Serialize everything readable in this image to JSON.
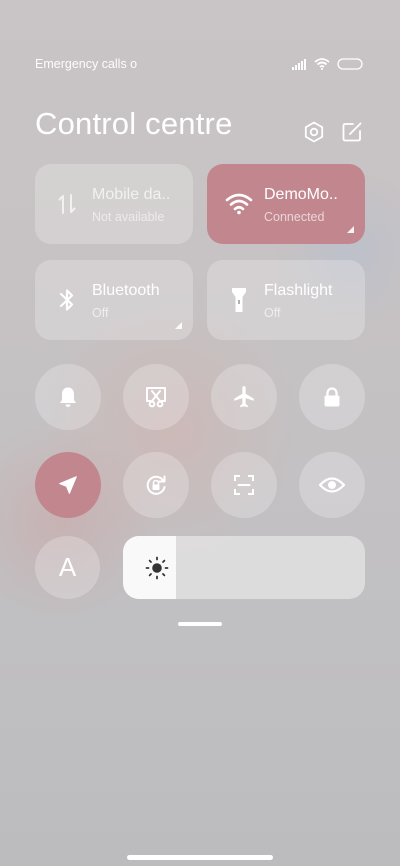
{
  "status_bar": {
    "carrier_text": "Emergency calls o"
  },
  "header": {
    "title": "Control centre"
  },
  "tiles": [
    {
      "label": "Mobile da..",
      "sub": "Not available"
    },
    {
      "label": "DemoMo..",
      "sub": "Connected"
    },
    {
      "label": "Bluetooth",
      "sub": "Off"
    },
    {
      "label": "Flashlight",
      "sub": "Off"
    }
  ],
  "round_toggles": [
    {
      "icon": "bell-icon",
      "state": "off"
    },
    {
      "icon": "screenshot-scissors-icon",
      "state": "off"
    },
    {
      "icon": "airplane-icon",
      "state": "off"
    },
    {
      "icon": "lock-icon",
      "state": "off"
    },
    {
      "icon": "location-arrow-icon",
      "state": "on"
    },
    {
      "icon": "rotation-lock-icon",
      "state": "off"
    },
    {
      "icon": "scan-icon",
      "state": "off"
    },
    {
      "icon": "eye-icon",
      "state": "off"
    }
  ],
  "auto_brightness": {
    "label": "A"
  },
  "brightness": {
    "level": 0.22
  },
  "colors": {
    "accent_active": "#c2878e"
  }
}
